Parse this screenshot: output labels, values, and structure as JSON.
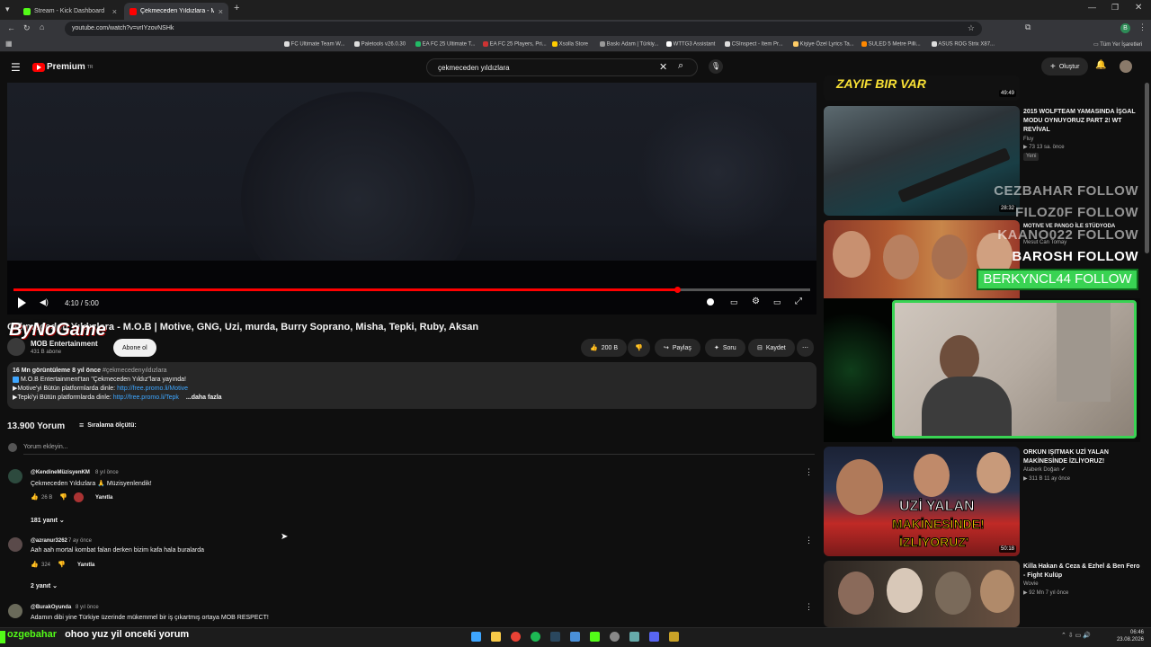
{
  "browser": {
    "tabs": [
      {
        "title": "Stream - Kick Dashboard",
        "icon": "kick-icon"
      },
      {
        "title": "Çekmeceden Yıldızlara - M.O.B",
        "icon": "youtube-icon"
      }
    ],
    "url": "youtube.com/watch?v=vrIYzovNSHk",
    "bookmarks": [
      "FC Ultimate Team W...",
      "Paletools v26.0.30",
      "EA FC 25 Ultimate T...",
      "EA FC 25 Players, Pri...",
      "Xsolla Store",
      "Baskı Adam | Türkiy...",
      "WTTG3 Assistant",
      "CSInspect - Item Pr...",
      "Kişiye Özel Lyrics Ta...",
      "SULED 5 Metre Pilli...",
      "ASUS ROG Strix X87..."
    ],
    "bookmarks_folder": "Tüm Yer İşaretleri"
  },
  "youtube": {
    "logo": "Premium",
    "logo_sup": "TR",
    "search_value": "çekmeceden yıldızlara",
    "create_label": "Oluştur"
  },
  "player": {
    "time": "4:10 / 5:00",
    "progress": 0.833
  },
  "video": {
    "title": "Çekmeceden Yıldızlara - M.O.B | Motive, GNG, Uzi, murda, Burry Soprano, Misha, Tepki, Ruby, Aksan",
    "channel": "MOB Entertainment",
    "subscribers": "431 B abone",
    "subscribe_label": "Abone ol",
    "likes": "200 B",
    "share_label": "Paylaş",
    "ask_label": "Soru",
    "save_label": "Kaydet",
    "desc_meta": "16 Mn görüntüleme  8 yıl önce",
    "desc_hashtag": "#çekmecedenyıldızlara",
    "desc_line1": "M.O.B Entertainment'tan \"Çekmeceden Yıldız\"lara yayında!",
    "desc_line2_prefix": "▶Motive'yi Bütün platformlarda dinle: ",
    "desc_line2_link": "http://free.promo.li/Motive",
    "desc_line3_prefix": "▶Tepki'yi Bütün platformlarda dinle: ",
    "desc_line3_link": "http://free.promo.li/Tepk",
    "desc_more": "...daha fazla"
  },
  "overlay": {
    "watermark": "ByNoGame"
  },
  "comments": {
    "count_label": "13.900 Yorum",
    "sort_label": "Sıralama ölçütü:",
    "add_placeholder": "Yorum ekleyin...",
    "items": [
      {
        "author": "@KendineMüzisyenKM",
        "time": "8 yıl önce",
        "text": "Çekmeceden Yıldızlara 🙏 Müzisyenlendik!",
        "likes": "26 B",
        "reply": "Yanıtla",
        "replies": "181 yanıt"
      },
      {
        "author": "@azranur3262",
        "time": "7 ay önce",
        "text": "Aah aah mortal kombat falan derken bizim kafa hala buralarda",
        "likes": "324",
        "reply": "Yanıtla",
        "replies": "2 yanıt"
      },
      {
        "author": "@BurakOyunda",
        "time": "8 yıl önce",
        "text": "Adamın dibi yine Türkiye üzerinde mükemmel bir iş çıkartmış ortaya MOB RESPECT!"
      }
    ]
  },
  "sidebar": {
    "items": [
      {
        "title": "",
        "duration": "49:49",
        "thumb_text": "ZAYIF BIR VAR"
      },
      {
        "title": "2015 WOLFTEAM YAMASINDA İŞGAL MODU OYNUYORUZ PART 2! WT REVİVAL",
        "channel": "Fluy",
        "meta": "▶ 73  13 sa. önce",
        "badge": "Yeni",
        "duration": "28:32"
      },
      {
        "title": "MOTIVE VE PANGO İLE STÜDYODA",
        "channel": "Mesut Can Tomay",
        "duration": ""
      },
      {
        "title": "ORKUN IŞITMAK UZİ YALAN MAKİNESİNDE İZLİYORUZ!",
        "channel": "Ataberk Doğan",
        "meta": "▶ 311 B  11 ay önce",
        "duration": "50:18",
        "thumb_text1": "UZİ YALAN",
        "thumb_text2": "MAKİNESİNDE!",
        "thumb_text3": "İZLİYORUZ'"
      },
      {
        "title": "Killa Hakan & Ceza & Ezhel & Ben Fero - Fight Kulüp",
        "channel": "Wovie",
        "meta": "▶ 92 Mn  7 yıl önce"
      }
    ],
    "follows": [
      "CEZBAHAR FOLLOW",
      "FILOZ0F FOLLOW",
      "KAANO022 FOLLOW",
      "BAROSH FOLLOW",
      "BERKYNCL44 FOLLOW"
    ]
  },
  "stream_chat": {
    "user": "ozgebahar",
    "message": "ohoo yuz yil onceki yorum"
  },
  "taskbar": {
    "clock_time": "06:46",
    "clock_date": "23.08.2026"
  },
  "colors": {
    "accent_red": "#ff0000",
    "follow_green": "#39d353",
    "kick_green": "#53fc18"
  }
}
